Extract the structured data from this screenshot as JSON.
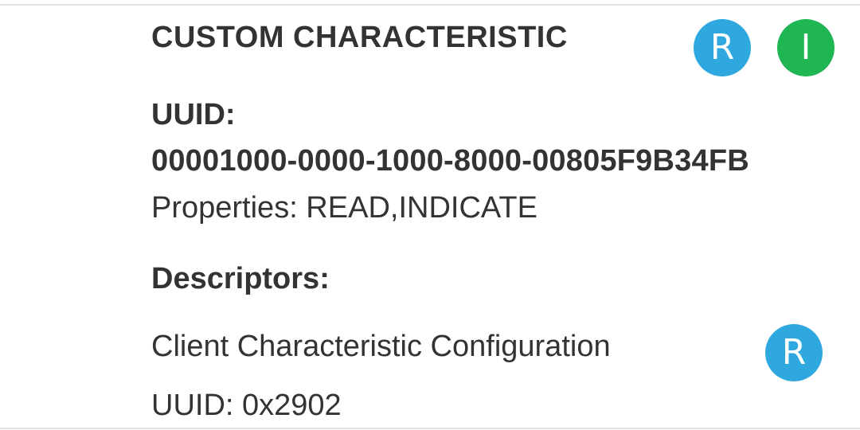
{
  "characteristic": {
    "title": "CUSTOM CHARACTERISTIC",
    "uuid_label": "UUID:",
    "uuid_value": "00001000-0000-1000-8000-00805F9B34FB",
    "properties": "Properties: READ,INDICATE",
    "actions": {
      "read_label": "R",
      "indicate_label": "I"
    }
  },
  "descriptors": {
    "heading": "Descriptors:",
    "items": [
      {
        "name": "Client Characteristic Configuration",
        "uuid": "UUID: 0x2902",
        "read_label": "R"
      }
    ]
  },
  "colors": {
    "read_button": "#2ea8df",
    "indicate_button": "#21b654",
    "text": "#333333"
  }
}
